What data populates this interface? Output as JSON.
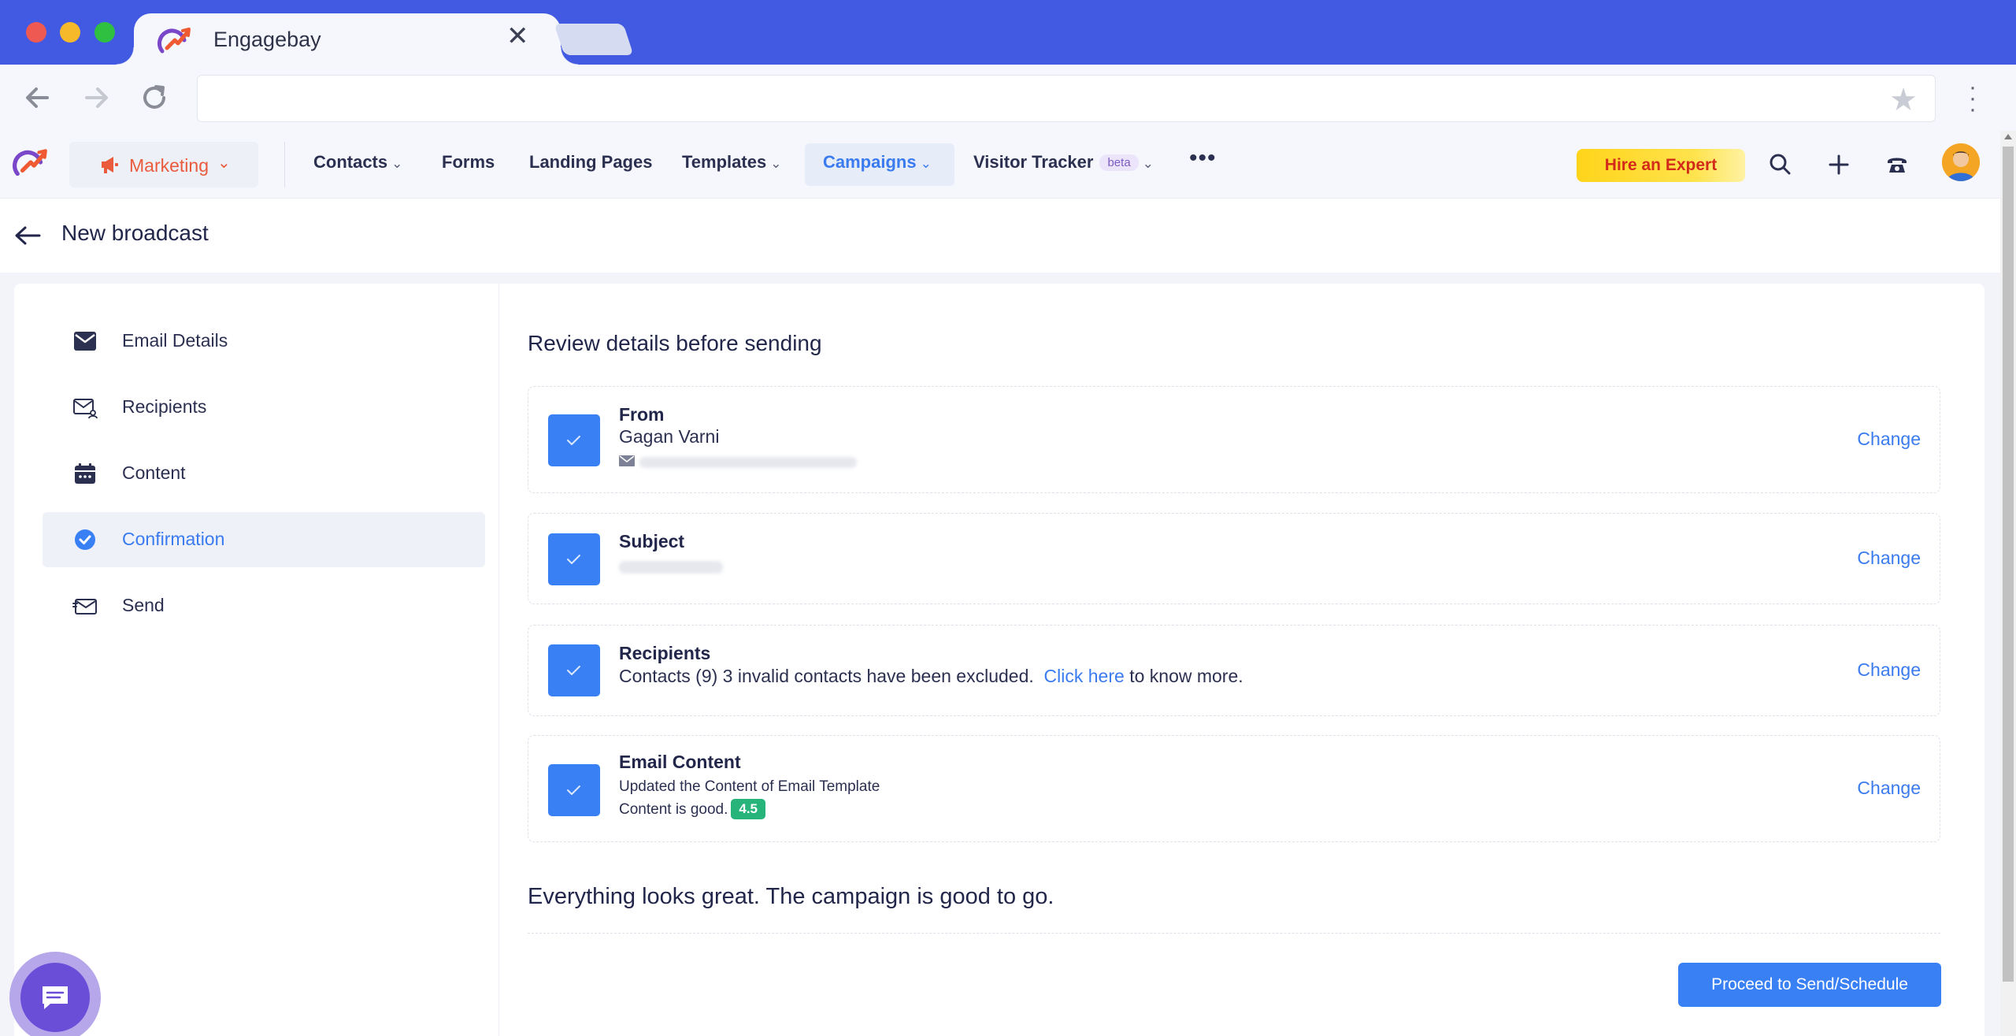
{
  "browser": {
    "tab_title": "Engagebay",
    "tab_close": "✕",
    "address": ""
  },
  "header": {
    "module": "Marketing",
    "nav": [
      {
        "label": "Contacts",
        "has_dropdown": true
      },
      {
        "label": "Forms",
        "has_dropdown": false
      },
      {
        "label": "Landing Pages",
        "has_dropdown": false
      },
      {
        "label": "Templates",
        "has_dropdown": true
      },
      {
        "label": "Campaigns",
        "has_dropdown": true,
        "active": true
      },
      {
        "label": "Visitor Tracker",
        "badge": "beta",
        "has_dropdown": true
      }
    ],
    "hire_button": "Hire an Expert",
    "icons": [
      "search-icon",
      "plus-icon",
      "phone-icon",
      "avatar"
    ]
  },
  "page": {
    "title": "New broadcast"
  },
  "sidebar": {
    "steps": [
      {
        "label": "Email Details",
        "icon": "envelope-icon",
        "active": false
      },
      {
        "label": "Recipients",
        "icon": "recipients-icon",
        "active": false
      },
      {
        "label": "Content",
        "icon": "calendar-icon",
        "active": false
      },
      {
        "label": "Confirmation",
        "icon": "check-circle-icon",
        "active": true
      },
      {
        "label": "Send",
        "icon": "send-icon",
        "active": false
      }
    ]
  },
  "review": {
    "title": "Review details before sending",
    "from": {
      "heading": "From",
      "name": "Gagan Varni",
      "change": "Change"
    },
    "subject": {
      "heading": "Subject",
      "change": "Change"
    },
    "recipients": {
      "heading": "Recipients",
      "text": "Contacts (9) 3 invalid contacts have been excluded.",
      "link": "Click here",
      "suffix": "to know more.",
      "change": "Change"
    },
    "content": {
      "heading": "Email Content",
      "line1": "Updated the Content of Email Template",
      "line2": "Content is good.",
      "score": "4.5",
      "change": "Change"
    },
    "message": "Everything looks great. The campaign is good to go.",
    "proceed_button": "Proceed to Send/Schedule"
  },
  "colors": {
    "browser_chrome": "#4259e1",
    "accent_blue": "#3a80f5",
    "marketing_orange": "#ea5a3c",
    "score_green": "#27b47a",
    "hire_yellow": "#ffd41a",
    "chat_purple": "#6a4ed8"
  }
}
